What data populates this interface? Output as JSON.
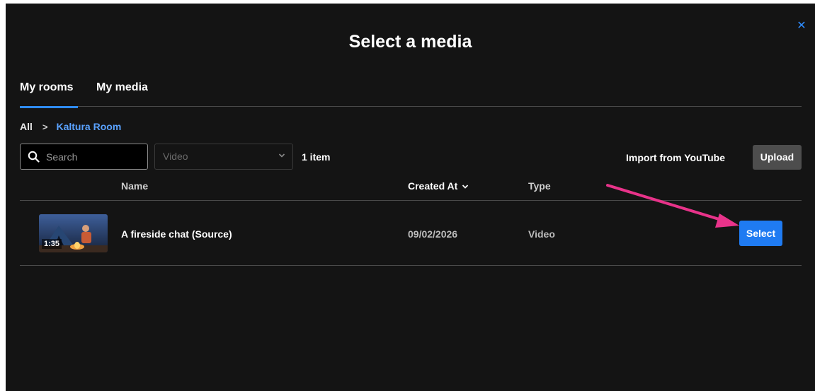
{
  "dialog": {
    "title": "Select a media",
    "close_icon": "close-icon",
    "accent": "#2f8cff"
  },
  "tabs": [
    {
      "label": "My rooms",
      "active": true
    },
    {
      "label": "My media",
      "active": false
    }
  ],
  "breadcrumb": {
    "root": "All",
    "separator": ">",
    "current": "Kaltura Room"
  },
  "toolbar": {
    "search_placeholder": "Search",
    "filter_value": "Video",
    "item_count": "1 item",
    "import_label": "Import from YouTube",
    "upload_label": "Upload"
  },
  "table": {
    "columns": {
      "name": "Name",
      "created": "Created At",
      "type": "Type"
    },
    "rows": [
      {
        "duration": "1:35",
        "name": "A fireside chat (Source)",
        "created": "09/02/2026",
        "type": "Video",
        "action": "Select"
      }
    ]
  },
  "colors": {
    "background": "#141414",
    "primary_button": "#1f7bf2",
    "annotation_arrow": "#e8338a"
  }
}
